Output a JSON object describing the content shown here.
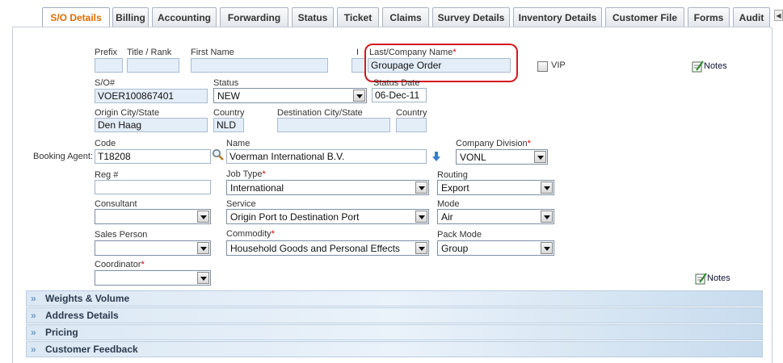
{
  "tabs": [
    {
      "label": "S/O Details",
      "active": true
    },
    {
      "label": "Billing"
    },
    {
      "label": "Accounting"
    },
    {
      "label": "Forwarding"
    },
    {
      "label": "Status"
    },
    {
      "label": "Ticket"
    },
    {
      "label": "Claims"
    },
    {
      "label": "Survey Details"
    },
    {
      "label": "Inventory Details"
    },
    {
      "label": "Customer File"
    },
    {
      "label": "Forms"
    },
    {
      "label": "Audit"
    }
  ],
  "tab_scroll_icon": "chevron-left-icon",
  "form": {
    "prefix": {
      "label": "Prefix",
      "value": ""
    },
    "title_rank": {
      "label": "Title / Rank",
      "value": ""
    },
    "first_name": {
      "label": "First Name",
      "value": ""
    },
    "initial": {
      "label": "I",
      "value": ""
    },
    "last_name": {
      "label": "Last/Company Name",
      "required": "*",
      "value": "Groupage Order"
    },
    "vip": {
      "label": "VIP",
      "checked": false
    },
    "notes_label": "Notes",
    "so_number": {
      "label": "S/O#",
      "value": "VOER100867401"
    },
    "status": {
      "label": "Status",
      "value": "NEW"
    },
    "status_date": {
      "label": "Status Date",
      "value": "06-Dec-11"
    },
    "origin_city": {
      "label": "Origin  City/State",
      "value": "Den Haag"
    },
    "origin_country": {
      "label": "Country",
      "value": "NLD"
    },
    "dest_city": {
      "label": "Destination City/State",
      "value": ""
    },
    "dest_country": {
      "label": "Country",
      "value": ""
    },
    "booking_agent_label": "Booking Agent:",
    "code": {
      "label": "Code",
      "value": "T18208"
    },
    "name": {
      "label": "Name",
      "value": "Voerman International B.V."
    },
    "company_division": {
      "label": "Company Division",
      "required": "*",
      "value": "VONL"
    },
    "reg_no": {
      "label": "Reg #",
      "value": ""
    },
    "job_type": {
      "label": "Job Type",
      "required": "*",
      "value": "International"
    },
    "routing": {
      "label": "Routing",
      "value": "Export"
    },
    "consultant": {
      "label": "Consultant",
      "value": ""
    },
    "service": {
      "label": "Service",
      "value": "Origin Port to Destination Port"
    },
    "mode": {
      "label": "Mode",
      "value": "Air"
    },
    "sales_person": {
      "label": "Sales Person",
      "value": ""
    },
    "commodity": {
      "label": "Commodity",
      "required": "*",
      "value": "Household Goods and Personal Effects"
    },
    "pack_mode": {
      "label": "Pack Mode",
      "value": "Group"
    },
    "coordinator": {
      "label": "Coordinator",
      "required": "*",
      "value": ""
    }
  },
  "sections": [
    "Weights & Volume",
    "Address Details",
    "Pricing",
    "Customer Feedback"
  ],
  "colors": {
    "active_tab": "#e06d00",
    "highlight": "#d41820",
    "readonly_field": "#e4eef9",
    "section_bar": "#dbe8f4"
  }
}
